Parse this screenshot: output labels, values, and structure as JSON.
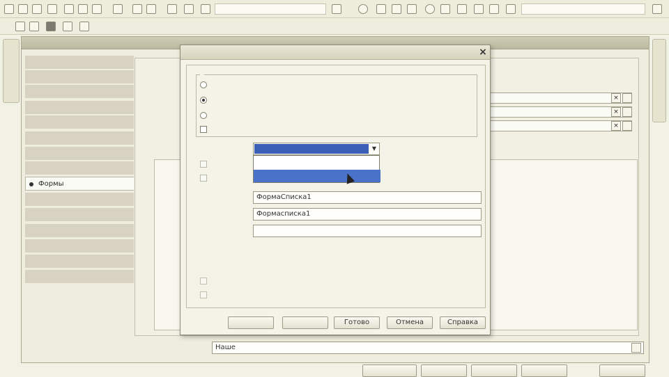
{
  "dialog": {
    "close_glyph": "×",
    "group_options": [
      "",
      "",
      "",
      ""
    ],
    "type_dropdown": {
      "selected": "",
      "options": [
        "",
        ""
      ]
    },
    "fields": {
      "name_value": "ФормаСписка1",
      "synonym_value": "Формасписка1",
      "comment_value": ""
    },
    "bottom_checks": [
      "",
      ""
    ],
    "buttons": {
      "back": "",
      "next": "",
      "finish": "Готово",
      "cancel": "Отмена",
      "help": "Справка"
    }
  },
  "main_window": {
    "nav_items": [
      "",
      "",
      "",
      "",
      "",
      "",
      "",
      "",
      "Формы",
      "",
      "",
      "",
      "",
      "",
      ""
    ],
    "active_nav_index": 8,
    "bottom_field_value": "Наше"
  },
  "colors": {
    "dropdown_selected": "#3a5fb4",
    "dropdown_highlight": "#4a72c8",
    "background": "#f2f1e6"
  }
}
